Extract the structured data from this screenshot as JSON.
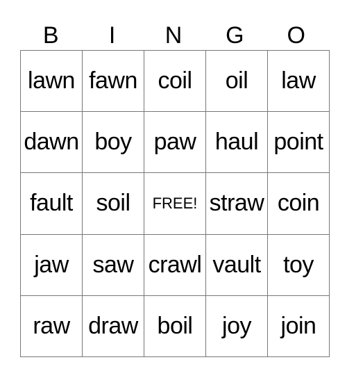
{
  "header": {
    "letters": [
      "B",
      "I",
      "N",
      "G",
      "O"
    ]
  },
  "board": {
    "rows": [
      [
        "lawn",
        "fawn",
        "coil",
        "oil",
        "law"
      ],
      [
        "dawn",
        "boy",
        "paw",
        "haul",
        "point"
      ],
      [
        "fault",
        "soil",
        "FREE!",
        "straw",
        "coin"
      ],
      [
        "jaw",
        "saw",
        "crawl",
        "vault",
        "toy"
      ],
      [
        "raw",
        "draw",
        "boil",
        "joy",
        "join"
      ]
    ]
  }
}
